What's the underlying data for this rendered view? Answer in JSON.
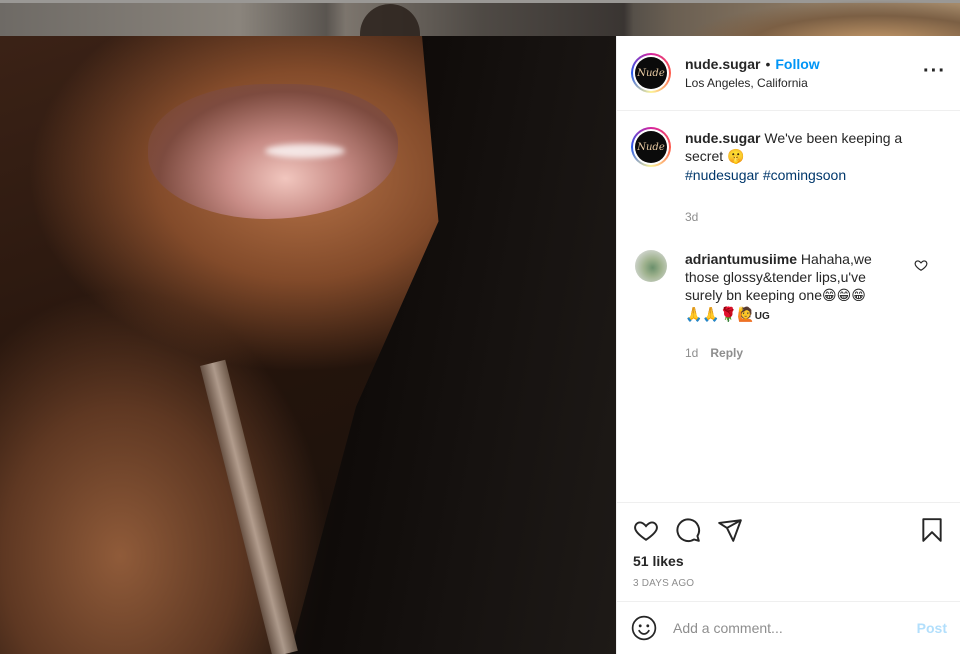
{
  "post": {
    "username": "nude.sugar",
    "follow_label": "Follow",
    "location": "Los Angeles, California",
    "avatar_text": "Nude"
  },
  "caption": {
    "username": "nude.sugar",
    "text": "We've been keeping a secret",
    "emoji": "🤫",
    "hashtags": [
      "#nudesugar",
      "#comingsoon"
    ],
    "time": "3d"
  },
  "comments": [
    {
      "username": "adriantumusiime",
      "text": "Hahaha,we those glossy&tender lips,u've surely bn keeping one",
      "emojis": "😁😁😁",
      "emojis2": "🙏🙏🌹🙋",
      "suffix": "UG",
      "time": "1d",
      "reply_label": "Reply"
    }
  ],
  "actions": {
    "likes": "51 likes",
    "time_ago": "3 DAYS AGO"
  },
  "add_comment": {
    "placeholder": "Add a comment...",
    "post_label": "Post"
  },
  "colors": {
    "link": "#0095f6",
    "hashtag": "#00376b",
    "muted": "#8e8e8e",
    "post_disabled": "#b2dffc"
  },
  "icons": [
    "more-icon",
    "heart-icon",
    "comment-icon",
    "share-icon",
    "bookmark-icon",
    "emoji-icon",
    "small-heart-icon"
  ]
}
